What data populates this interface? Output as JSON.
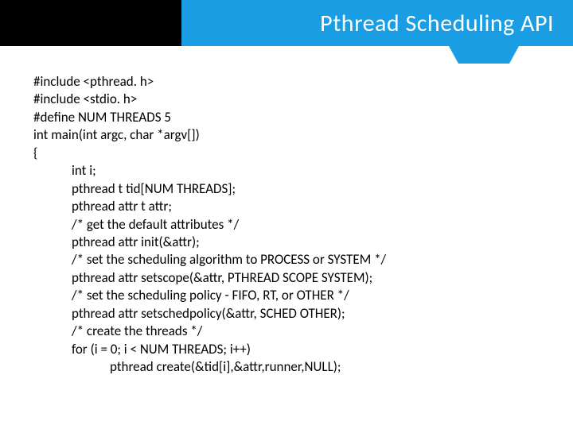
{
  "title": "Pthread Scheduling API",
  "code": {
    "l01": "#include <pthread. h>",
    "l02": "#include <stdio. h>",
    "l03": "#define NUM THREADS 5",
    "l04": "int main(int argc, char *argv[])",
    "l05": "{",
    "l06": "int i;",
    "l07": "pthread t tid[NUM THREADS];",
    "l08": "pthread attr t attr;",
    "l09": "/* get the default attributes */",
    "l10": "pthread attr init(&attr);",
    "l11": "/* set the scheduling algorithm to PROCESS or SYSTEM */",
    "l12": "pthread attr setscope(&attr, PTHREAD SCOPE SYSTEM);",
    "l13": "/* set the scheduling policy - FIFO, RT, or OTHER */",
    "l14": "pthread attr setschedpolicy(&attr, SCHED OTHER);",
    "l15": "/* create the threads */",
    "l16": "for (i = 0; i < NUM THREADS; i++)",
    "l17": "pthread create(&tid[i],&attr,runner,NULL);"
  }
}
